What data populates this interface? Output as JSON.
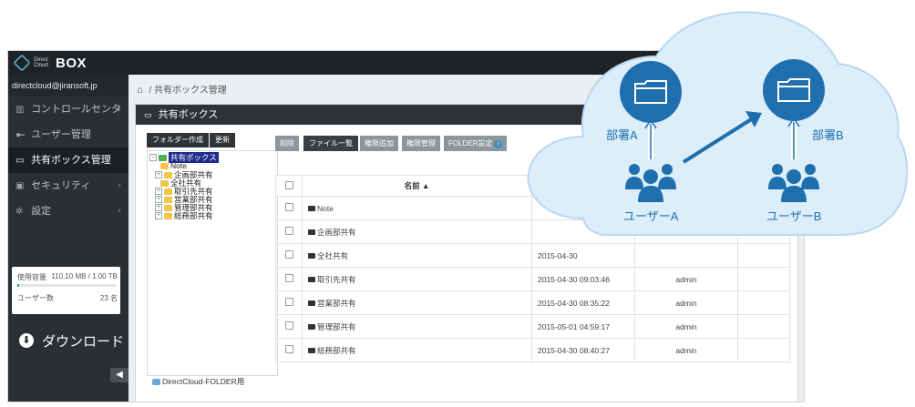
{
  "app": {
    "logo_small": "Direct Cloud",
    "logo_big": "BOX"
  },
  "sidebar": {
    "user_email": "directcloud@jiransoft.jp",
    "items": [
      {
        "label": "コントロールセンター",
        "icon": "bar-chart-icon",
        "chevron": "‹"
      },
      {
        "label": "ユーザー管理",
        "icon": "users-icon",
        "chevron": ""
      },
      {
        "label": "共有ボックス管理",
        "icon": "inbox-icon",
        "chevron": ""
      },
      {
        "label": "セキュリティ",
        "icon": "lock-icon",
        "chevron": "‹"
      },
      {
        "label": "設定",
        "icon": "gear-icon",
        "chevron": "‹"
      }
    ],
    "usage": {
      "label": "使用容量",
      "value": "110.10 MB / 1.00 TB",
      "fraction": 0.0001
    },
    "users": {
      "label": "ユーザー数",
      "value": "23 名"
    },
    "download_label": "ダウンロード"
  },
  "breadcrumb": {
    "sep": "/",
    "current": "共有ボックス管理"
  },
  "panel": {
    "title": "共有ボックス"
  },
  "tree_toolbar": {
    "create_folder": "フォルダー作成",
    "refresh": "更新"
  },
  "tree": {
    "root": "共有ボックス",
    "children": [
      "Note",
      "企画部共有",
      "全社共有",
      "取引先共有",
      "営業部共有",
      "管理部共有",
      "総務部共有"
    ],
    "footer": "DirectCloud-FOLDER用"
  },
  "file_toolbar": {
    "delete": "削除",
    "file_list": "ファイル一覧",
    "add_permission": "権限追加",
    "manage_permission": "権限管理",
    "folder_settings": "FOLDER設定"
  },
  "table": {
    "header_name": "名前 ▲",
    "rows": [
      {
        "name": "Note",
        "date": "",
        "user": ""
      },
      {
        "name": "企画部共有",
        "date": "",
        "user": ""
      },
      {
        "name": "全社共有",
        "date": "2015-04-30",
        "user": ""
      },
      {
        "name": "取引先共有",
        "date": "2015-04-30 09:03:46",
        "user": "admin"
      },
      {
        "name": "営業部共有",
        "date": "2015-04-30 08:35:22",
        "user": "admin"
      },
      {
        "name": "管理部共有",
        "date": "2015-05-01 04:59:17",
        "user": "admin"
      },
      {
        "name": "総務部共有",
        "date": "2015-04-30 08:40:27",
        "user": "admin"
      }
    ]
  },
  "overlay": {
    "dept_a": "部署A",
    "dept_b": "部署B",
    "user_a": "ユーザーA",
    "user_b": "ユーザーB"
  },
  "colors": {
    "cloud_fill": "#dceefa",
    "cloud_stroke": "#b8d8ef",
    "accent_blue": "#1f6fae"
  }
}
